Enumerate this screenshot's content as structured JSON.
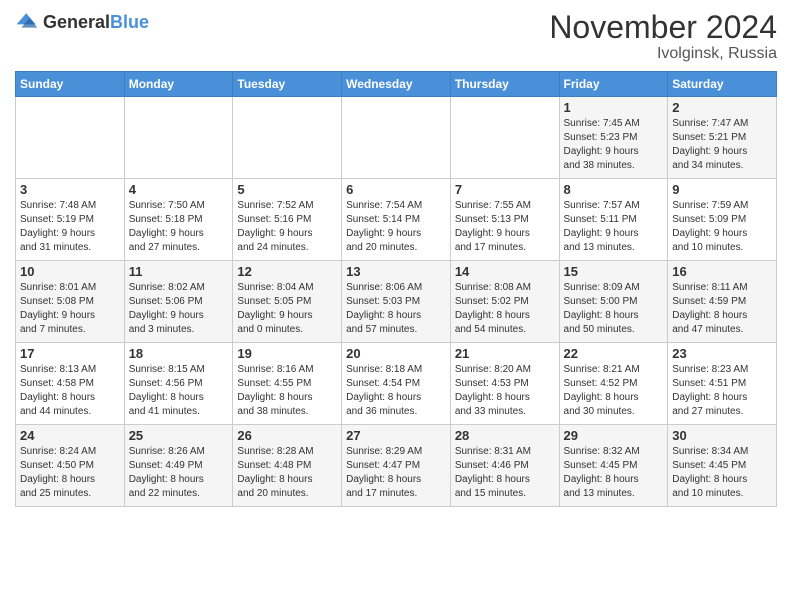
{
  "logo": {
    "general": "General",
    "blue": "Blue"
  },
  "header": {
    "month_title": "November 2024",
    "location": "Ivolginsk, Russia"
  },
  "days_of_week": [
    "Sunday",
    "Monday",
    "Tuesday",
    "Wednesday",
    "Thursday",
    "Friday",
    "Saturday"
  ],
  "weeks": [
    [
      {
        "day": "",
        "info": ""
      },
      {
        "day": "",
        "info": ""
      },
      {
        "day": "",
        "info": ""
      },
      {
        "day": "",
        "info": ""
      },
      {
        "day": "",
        "info": ""
      },
      {
        "day": "1",
        "info": "Sunrise: 7:45 AM\nSunset: 5:23 PM\nDaylight: 9 hours\nand 38 minutes."
      },
      {
        "day": "2",
        "info": "Sunrise: 7:47 AM\nSunset: 5:21 PM\nDaylight: 9 hours\nand 34 minutes."
      }
    ],
    [
      {
        "day": "3",
        "info": "Sunrise: 7:48 AM\nSunset: 5:19 PM\nDaylight: 9 hours\nand 31 minutes."
      },
      {
        "day": "4",
        "info": "Sunrise: 7:50 AM\nSunset: 5:18 PM\nDaylight: 9 hours\nand 27 minutes."
      },
      {
        "day": "5",
        "info": "Sunrise: 7:52 AM\nSunset: 5:16 PM\nDaylight: 9 hours\nand 24 minutes."
      },
      {
        "day": "6",
        "info": "Sunrise: 7:54 AM\nSunset: 5:14 PM\nDaylight: 9 hours\nand 20 minutes."
      },
      {
        "day": "7",
        "info": "Sunrise: 7:55 AM\nSunset: 5:13 PM\nDaylight: 9 hours\nand 17 minutes."
      },
      {
        "day": "8",
        "info": "Sunrise: 7:57 AM\nSunset: 5:11 PM\nDaylight: 9 hours\nand 13 minutes."
      },
      {
        "day": "9",
        "info": "Sunrise: 7:59 AM\nSunset: 5:09 PM\nDaylight: 9 hours\nand 10 minutes."
      }
    ],
    [
      {
        "day": "10",
        "info": "Sunrise: 8:01 AM\nSunset: 5:08 PM\nDaylight: 9 hours\nand 7 minutes."
      },
      {
        "day": "11",
        "info": "Sunrise: 8:02 AM\nSunset: 5:06 PM\nDaylight: 9 hours\nand 3 minutes."
      },
      {
        "day": "12",
        "info": "Sunrise: 8:04 AM\nSunset: 5:05 PM\nDaylight: 9 hours\nand 0 minutes."
      },
      {
        "day": "13",
        "info": "Sunrise: 8:06 AM\nSunset: 5:03 PM\nDaylight: 8 hours\nand 57 minutes."
      },
      {
        "day": "14",
        "info": "Sunrise: 8:08 AM\nSunset: 5:02 PM\nDaylight: 8 hours\nand 54 minutes."
      },
      {
        "day": "15",
        "info": "Sunrise: 8:09 AM\nSunset: 5:00 PM\nDaylight: 8 hours\nand 50 minutes."
      },
      {
        "day": "16",
        "info": "Sunrise: 8:11 AM\nSunset: 4:59 PM\nDaylight: 8 hours\nand 47 minutes."
      }
    ],
    [
      {
        "day": "17",
        "info": "Sunrise: 8:13 AM\nSunset: 4:58 PM\nDaylight: 8 hours\nand 44 minutes."
      },
      {
        "day": "18",
        "info": "Sunrise: 8:15 AM\nSunset: 4:56 PM\nDaylight: 8 hours\nand 41 minutes."
      },
      {
        "day": "19",
        "info": "Sunrise: 8:16 AM\nSunset: 4:55 PM\nDaylight: 8 hours\nand 38 minutes."
      },
      {
        "day": "20",
        "info": "Sunrise: 8:18 AM\nSunset: 4:54 PM\nDaylight: 8 hours\nand 36 minutes."
      },
      {
        "day": "21",
        "info": "Sunrise: 8:20 AM\nSunset: 4:53 PM\nDaylight: 8 hours\nand 33 minutes."
      },
      {
        "day": "22",
        "info": "Sunrise: 8:21 AM\nSunset: 4:52 PM\nDaylight: 8 hours\nand 30 minutes."
      },
      {
        "day": "23",
        "info": "Sunrise: 8:23 AM\nSunset: 4:51 PM\nDaylight: 8 hours\nand 27 minutes."
      }
    ],
    [
      {
        "day": "24",
        "info": "Sunrise: 8:24 AM\nSunset: 4:50 PM\nDaylight: 8 hours\nand 25 minutes."
      },
      {
        "day": "25",
        "info": "Sunrise: 8:26 AM\nSunset: 4:49 PM\nDaylight: 8 hours\nand 22 minutes."
      },
      {
        "day": "26",
        "info": "Sunrise: 8:28 AM\nSunset: 4:48 PM\nDaylight: 8 hours\nand 20 minutes."
      },
      {
        "day": "27",
        "info": "Sunrise: 8:29 AM\nSunset: 4:47 PM\nDaylight: 8 hours\nand 17 minutes."
      },
      {
        "day": "28",
        "info": "Sunrise: 8:31 AM\nSunset: 4:46 PM\nDaylight: 8 hours\nand 15 minutes."
      },
      {
        "day": "29",
        "info": "Sunrise: 8:32 AM\nSunset: 4:45 PM\nDaylight: 8 hours\nand 13 minutes."
      },
      {
        "day": "30",
        "info": "Sunrise: 8:34 AM\nSunset: 4:45 PM\nDaylight: 8 hours\nand 10 minutes."
      }
    ]
  ]
}
